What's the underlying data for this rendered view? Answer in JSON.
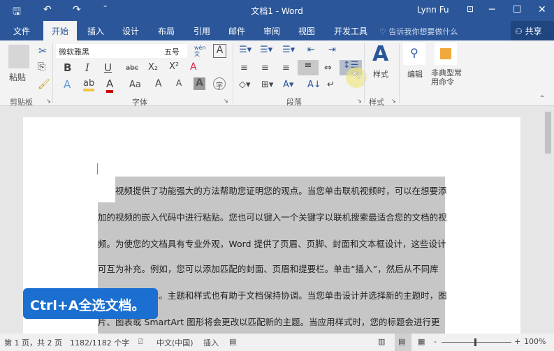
{
  "titlebar": {
    "title": "文档1 - Word",
    "user": "Lynn Fu",
    "icons": [
      "save-icon",
      "undo-icon",
      "redo-icon",
      "customize-icon",
      "ribbon-display-icon",
      "minimize-icon",
      "maximize-icon",
      "close-icon"
    ]
  },
  "tabs": [
    "文件",
    "开始",
    "插入",
    "设计",
    "布局",
    "引用",
    "邮件",
    "审阅",
    "视图",
    "开发工具"
  ],
  "active_tab": "开始",
  "tell_me": "告诉我你想要做什么",
  "share": "共享",
  "ribbon": {
    "clipboard": {
      "paste": "粘贴",
      "label": "剪贴板"
    },
    "font": {
      "name": "微软雅黑",
      "size": "五号",
      "label": "字体",
      "phonetic": "wén\n文",
      "bold": "B",
      "italic": "I",
      "underline": "U",
      "strike": "abc",
      "sub": "X₂",
      "sup": "X²",
      "change_case": "Aa",
      "grow": "A",
      "shrink": "A",
      "shade": "A",
      "enclose": "字"
    },
    "paragraph": {
      "label": "段落"
    },
    "styles": {
      "button": "样式",
      "label": "样式"
    },
    "editing": {
      "button": "编辑"
    },
    "custom": {
      "button": "非典型常用命令"
    }
  },
  "document": {
    "lines": [
      "视频提供了功能强大的方法帮助您证明您的观点。当您单击联机视频时，可以在想要添",
      "加的视频的嵌入代码中进行粘贴。您也可以键入一个关键字以联机搜索最适合您的文档的视",
      "频。为使您的文档具有专业外观，Word  提供了页眉、页脚、封面和文本框设计，这些设计",
      "可互为补充。例如，您可以添加匹配的封面、页眉和提要栏。单击“插入”，然后从不同库",
      "中选择所需元素。主题和样式也有助于文档保持协调。当您单击设计并选择新的主题时，图",
      "片、图表或  SmartArt  图形将会更改以匹配新的主题。当应用样式时，您的标题会进行更"
    ],
    "selection_color": "#c6c6c6"
  },
  "overlay": {
    "text": "Ctrl+A全选文档。",
    "color": "#1a6fd0"
  },
  "status": {
    "page": "第 1 页，共 2 页",
    "words": "1182/1182 个字",
    "language": "中文(中国)",
    "mode": "插入",
    "zoom": "100%",
    "zoom_minus": "-",
    "zoom_plus": "+",
    "zoom_level": 100
  },
  "colors": {
    "brand": "#2b579a"
  }
}
